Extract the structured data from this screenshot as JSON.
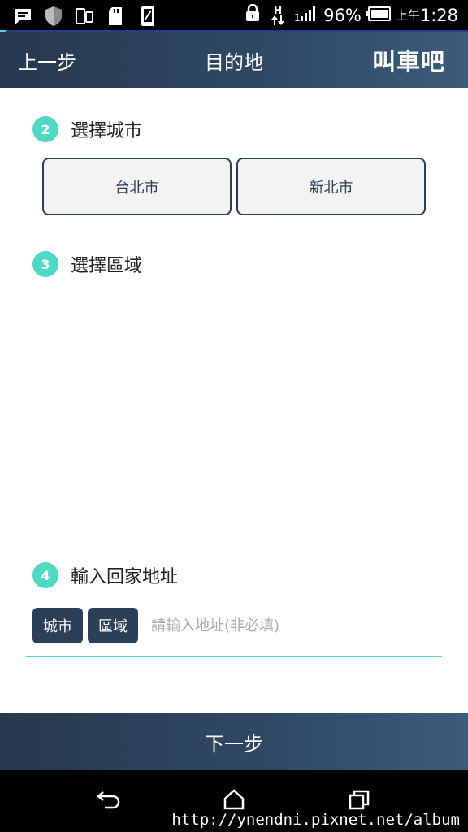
{
  "status_bar": {
    "battery": "96%",
    "time_prefix": "上午",
    "time": "1:28",
    "network": "H",
    "icons": [
      "message-icon",
      "shield-icon",
      "devices-icon",
      "sd-card-icon",
      "phone-icon",
      "lock-icon",
      "data-arrows-icon",
      "signal-icon",
      "battery-icon"
    ]
  },
  "header": {
    "back_label": "上一步",
    "title": "目的地",
    "logo": "叫車吧"
  },
  "step_city": {
    "number": "2",
    "title": "選擇城市"
  },
  "cities": [
    {
      "label": "台北市"
    },
    {
      "label": "新北市"
    }
  ],
  "step_district": {
    "number": "3",
    "title": "選擇區域"
  },
  "step_address": {
    "number": "4",
    "title": "輸入回家地址"
  },
  "address": {
    "city_label": "城市",
    "district_label": "區域",
    "placeholder": "請輸入地址(非必填)",
    "value": ""
  },
  "next_label": "下一步",
  "watermark": "http://ynendni.pixnet.net/album",
  "colors": {
    "accent": "#4fd8c4",
    "primary": "#2b3f58",
    "button_bg": "#f3f3f3"
  }
}
